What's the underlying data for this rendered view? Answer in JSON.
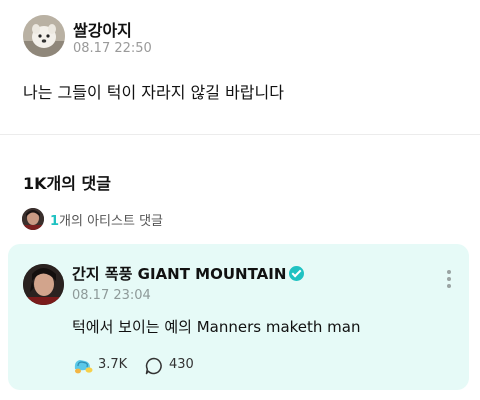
{
  "post": {
    "username": "쌀강아지",
    "timestamp": "08.17 22:50",
    "body": "나는 그들이 턱이 자라지 않길 바랍니다"
  },
  "comments": {
    "title": "1K개의 댓글",
    "artist_count_number": "1",
    "artist_count_suffix": "개의 아티스트 댓글"
  },
  "featured_comment": {
    "author": "간지 폭풍 GIANT MOUNTAIN",
    "verified": true,
    "timestamp": "08.17 23:04",
    "text": "턱에서 보이는 예의 Manners maketh man",
    "likes": "3.7K",
    "replies": "430"
  },
  "colors": {
    "accent": "#1fc2c2",
    "card_background": "#e6faf7"
  },
  "icons": [
    "verified-badge-icon",
    "more-options-icon",
    "like-icon",
    "reply-icon"
  ]
}
